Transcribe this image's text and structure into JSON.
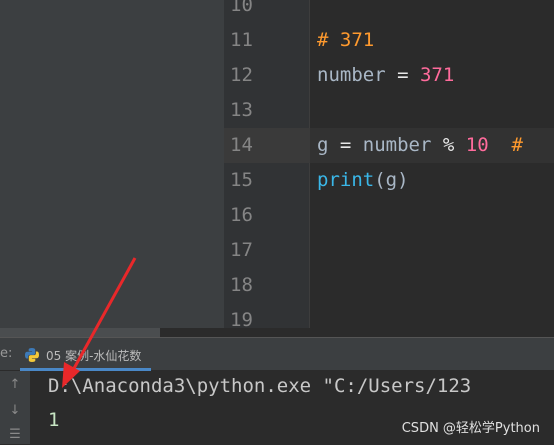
{
  "editor": {
    "lines": [
      {
        "n": "10",
        "tokens": []
      },
      {
        "n": "11",
        "tokens": [
          {
            "t": "# 371",
            "c": "comment"
          }
        ]
      },
      {
        "n": "12",
        "tokens": [
          {
            "t": "number",
            "c": "ident"
          },
          {
            "t": " = ",
            "c": "op"
          },
          {
            "t": "371",
            "c": "num"
          }
        ]
      },
      {
        "n": "13",
        "tokens": []
      },
      {
        "n": "14",
        "current": true,
        "tokens": [
          {
            "t": "g",
            "c": "ident"
          },
          {
            "t": " = ",
            "c": "op"
          },
          {
            "t": "number",
            "c": "ident"
          },
          {
            "t": " % ",
            "c": "op"
          },
          {
            "t": "10",
            "c": "num"
          },
          {
            "t": "  #",
            "c": "comment"
          }
        ]
      },
      {
        "n": "15",
        "tokens": [
          {
            "t": "print",
            "c": "func"
          },
          {
            "t": "(g)",
            "c": "paren"
          }
        ]
      },
      {
        "n": "16",
        "tokens": []
      },
      {
        "n": "17",
        "tokens": []
      },
      {
        "n": "18",
        "tokens": []
      },
      {
        "n": "19",
        "tokens": []
      }
    ]
  },
  "run_panel": {
    "prefix": "e:",
    "tab_label": "05 案例-水仙花数",
    "tab_icon": "python-icon",
    "side_buttons": [
      "↑",
      "↓",
      "☰"
    ]
  },
  "console": {
    "command": "D:\\Anaconda3\\python.exe \"C:/Users/123",
    "output": "1"
  },
  "watermark": "CSDN @轻松学Python",
  "colors": {
    "comment": "#ff9a2e",
    "number": "#ff6b9c",
    "function": "#3ab7e8",
    "arrow": "#e8282a"
  }
}
